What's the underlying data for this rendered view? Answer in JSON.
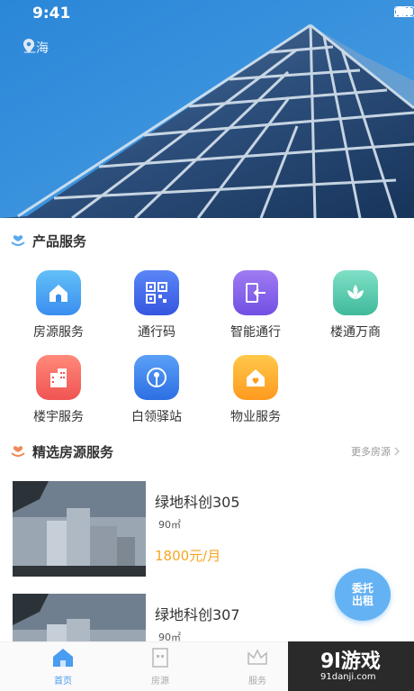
{
  "status_bar": {
    "time": "9:41"
  },
  "location": {
    "city": "上海"
  },
  "products": {
    "title": "产品服务",
    "items": [
      {
        "label": "房源服务",
        "icon": "house-icon",
        "color_top": "#63c0f7",
        "color_bottom": "#3a8ef0"
      },
      {
        "label": "通行码",
        "icon": "qrcode-icon",
        "color_top": "#5a86f6",
        "color_bottom": "#3556e0"
      },
      {
        "label": "智能通行",
        "icon": "door-enter-icon",
        "color_top": "#a07bf3",
        "color_bottom": "#7150e3"
      },
      {
        "label": "楼通万商",
        "icon": "lotus-icon",
        "color_top": "#7fe0c7",
        "color_bottom": "#3fb99a"
      },
      {
        "label": "楼宇服务",
        "icon": "building-icon",
        "color_top": "#ff8a7a",
        "color_bottom": "#f05353"
      },
      {
        "label": "白领驿站",
        "icon": "location-pin-icon",
        "color_top": "#5aa0f7",
        "color_bottom": "#2d6fe3"
      },
      {
        "label": "物业服务",
        "icon": "home-heart-icon",
        "color_top": "#ffc84a",
        "color_bottom": "#ff9a1f"
      }
    ]
  },
  "featured": {
    "title": "精选房源服务",
    "more": "更多房源",
    "listings": [
      {
        "name": "绿地科创305",
        "area": "90㎡",
        "price": "1800元/月"
      },
      {
        "name": "绿地科创307",
        "area": "90㎡",
        "price": ""
      }
    ]
  },
  "fab": {
    "line1": "委托",
    "line2": "出租"
  },
  "tabs": [
    {
      "label": "首页",
      "active": true
    },
    {
      "label": "房源",
      "active": false
    },
    {
      "label": "服务",
      "active": false
    }
  ],
  "watermark": {
    "logo": "9l游戏",
    "url": "91danji.com"
  },
  "colors": {
    "accent": "#4a9cf0",
    "price": "#f5a623",
    "fab": "#64b2f3"
  }
}
